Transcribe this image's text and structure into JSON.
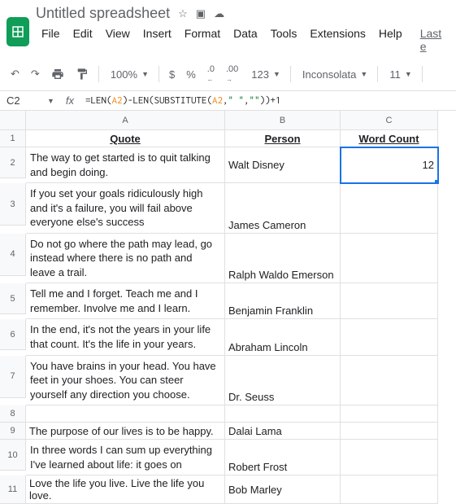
{
  "doc_title": "Untitled spreadsheet",
  "menu": {
    "file": "File",
    "edit": "Edit",
    "view": "View",
    "insert": "Insert",
    "format": "Format",
    "data": "Data",
    "tools": "Tools",
    "extensions": "Extensions",
    "help": "Help",
    "last": "Last e"
  },
  "toolbar": {
    "zoom": "100%",
    "dollar": "$",
    "percent": "%",
    "dec_dec": ".0",
    "dec_inc": ".00",
    "num": "123",
    "font": "Inconsolata",
    "size": "11"
  },
  "formula": {
    "cell": "C2",
    "fx": "fx",
    "p1": "=",
    "f1": "LEN",
    "p2": "(",
    "r1": "A2",
    "p3": ")-",
    "f2": "LEN",
    "p4": "(",
    "f3": "SUBSTITUTE",
    "p5": "(",
    "r2": "A2",
    "p6": ",",
    "s1": "\" \"",
    "p7": ",",
    "s2": "\"\"",
    "p8": "))+1"
  },
  "cols": {
    "a": "A",
    "b": "B",
    "c": "C"
  },
  "headers": {
    "quote": "Quote",
    "person": "Person",
    "wc": "Word Count"
  },
  "rows": [
    {
      "n": "1"
    },
    {
      "n": "2",
      "quote": "The way to get started is to quit talking and begin doing.",
      "person": "Walt Disney",
      "wc": "12"
    },
    {
      "n": "3",
      "quote": "If you set your goals ridiculously high and it's a failure, you will fail above everyone else's success",
      "person": "James Cameron",
      "wc": ""
    },
    {
      "n": "4",
      "quote": "Do not go where the path may lead, go instead where there is no path and leave a trail.",
      "person": "Ralph Waldo Emerson",
      "wc": ""
    },
    {
      "n": "5",
      "quote": "Tell me and I forget. Teach me and I remember. Involve me and I learn.",
      "person": "Benjamin Franklin",
      "wc": ""
    },
    {
      "n": "6",
      "quote": "In the end, it's not the years in your life that count. It's the life in your years.",
      "person": "Abraham Lincoln",
      "wc": ""
    },
    {
      "n": "7",
      "quote": "You have brains in your head. You have feet in your shoes. You can steer yourself any direction you choose.",
      "person": "Dr. Seuss",
      "wc": ""
    },
    {
      "n": "8",
      "quote": "",
      "person": "",
      "wc": ""
    },
    {
      "n": "9",
      "quote": "The purpose of our lives is to be happy.",
      "person": "Dalai Lama",
      "wc": ""
    },
    {
      "n": "10",
      "quote": "In three words I can sum up everything I've learned about life: it goes on",
      "person": "Robert Frost",
      "wc": ""
    },
    {
      "n": "11",
      "quote": "Love the life you live. Live the life you love.",
      "person": "Bob Marley",
      "wc": ""
    }
  ]
}
